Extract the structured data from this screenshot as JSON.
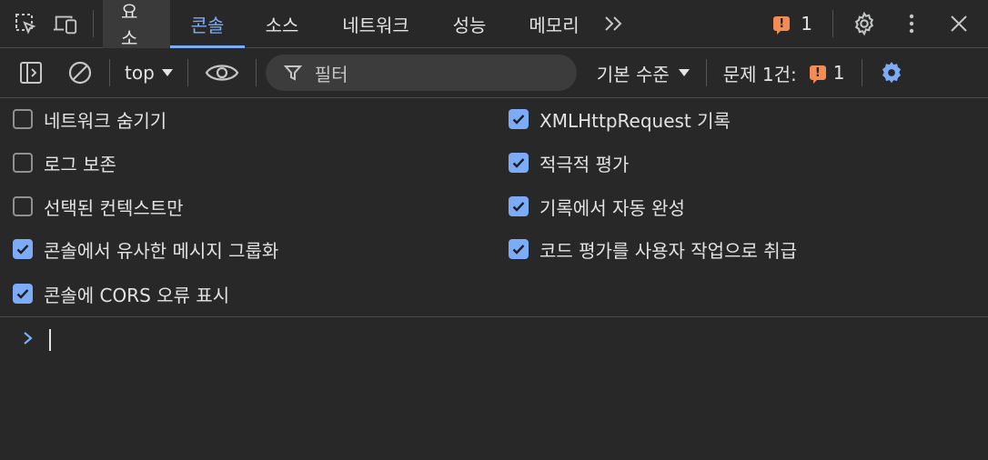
{
  "tabs": [
    {
      "label": "요소"
    },
    {
      "label": "콘솔"
    },
    {
      "label": "소스"
    },
    {
      "label": "네트워크"
    },
    {
      "label": "성능"
    },
    {
      "label": "메모리"
    }
  ],
  "header": {
    "issue_count": "1"
  },
  "toolbar": {
    "context": "top",
    "filter_placeholder": "필터",
    "level": "기본 수준",
    "issues_label": "문제 1건:",
    "issues_count": "1"
  },
  "settings": {
    "left": [
      {
        "label": "네트워크 숨기기",
        "checked": false
      },
      {
        "label": "로그 보존",
        "checked": false
      },
      {
        "label": "선택된 컨텍스트만",
        "checked": false
      },
      {
        "label": "콘솔에서 유사한 메시지 그룹화",
        "checked": true
      },
      {
        "label": "콘솔에 CORS 오류 표시",
        "checked": true
      }
    ],
    "right": [
      {
        "label": "XMLHttpRequest 기록",
        "checked": true
      },
      {
        "label": "적극적 평가",
        "checked": true
      },
      {
        "label": "기록에서 자동 완성",
        "checked": true
      },
      {
        "label": "코드 평가를 사용자 작업으로 취급",
        "checked": true
      }
    ]
  },
  "colors": {
    "accent": "#7cacf8",
    "warning": "#f28b54",
    "background": "#282828"
  }
}
